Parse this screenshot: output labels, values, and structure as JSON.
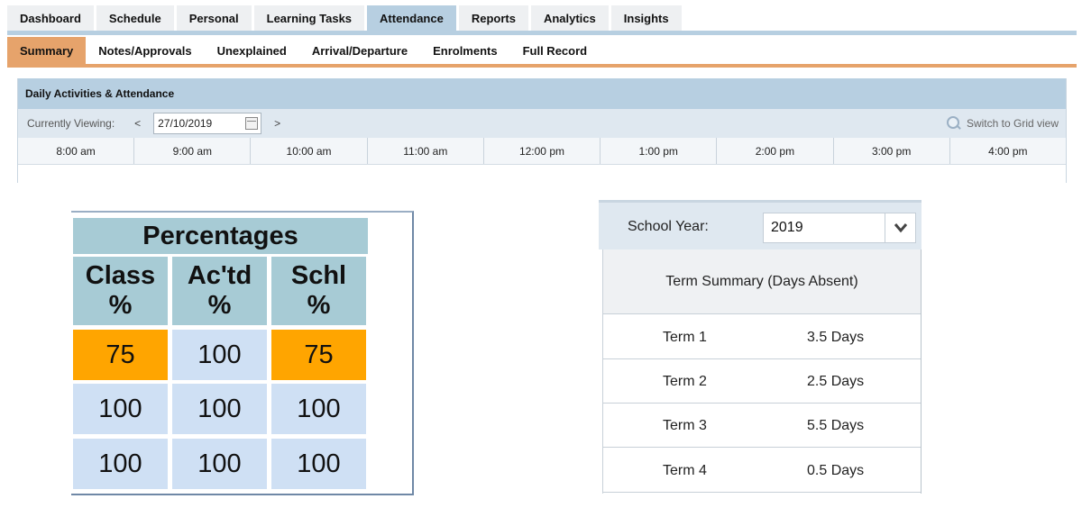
{
  "top_tabs": [
    "Dashboard",
    "Schedule",
    "Personal",
    "Learning Tasks",
    "Attendance",
    "Reports",
    "Analytics",
    "Insights"
  ],
  "active_top_tab": "Attendance",
  "sub_tabs": [
    "Summary",
    "Notes/Approvals",
    "Unexplained",
    "Arrival/Departure",
    "Enrolments",
    "Full Record"
  ],
  "active_sub_tab": "Summary",
  "daily": {
    "title": "Daily Activities & Attendance",
    "viewing_label": "Currently Viewing:",
    "prev": "<",
    "next": ">",
    "date": "27/10/2019",
    "grid_view": "Switch to Grid view",
    "times": [
      "8:00 am",
      "9:00 am",
      "10:00 am",
      "11:00 am",
      "12:00 pm",
      "1:00 pm",
      "2:00 pm",
      "3:00 pm",
      "4:00 pm"
    ]
  },
  "percentages": {
    "title": "Percentages",
    "columns": [
      {
        "line1": "Class",
        "line2": "%"
      },
      {
        "line1": "Ac'td",
        "line2": "%"
      },
      {
        "line1": "Schl",
        "line2": "%"
      }
    ],
    "rows": [
      [
        {
          "value": "75",
          "highlight": true
        },
        {
          "value": "100",
          "highlight": false
        },
        {
          "value": "75",
          "highlight": true
        }
      ],
      [
        {
          "value": "100",
          "highlight": false
        },
        {
          "value": "100",
          "highlight": false
        },
        {
          "value": "100",
          "highlight": false
        }
      ],
      [
        {
          "value": "100",
          "highlight": false
        },
        {
          "value": "100",
          "highlight": false
        },
        {
          "value": "100",
          "highlight": false
        }
      ]
    ],
    "highlight_color": "#ffa500"
  },
  "term_summary": {
    "school_year_label": "School Year:",
    "school_year": "2019",
    "title": "Term Summary (Days Absent)",
    "terms": [
      {
        "term": "Term 1",
        "days": "3.5 Days"
      },
      {
        "term": "Term 2",
        "days": "2.5 Days"
      },
      {
        "term": "Term 3",
        "days": "5.5 Days"
      },
      {
        "term": "Term 4",
        "days": "0.5 Days"
      }
    ]
  },
  "colors": {
    "tab_active": "#b7cfe1",
    "subtab_active": "#e6a36b",
    "table_header": "#a7cbd5",
    "table_cell": "#cfe0f4"
  }
}
